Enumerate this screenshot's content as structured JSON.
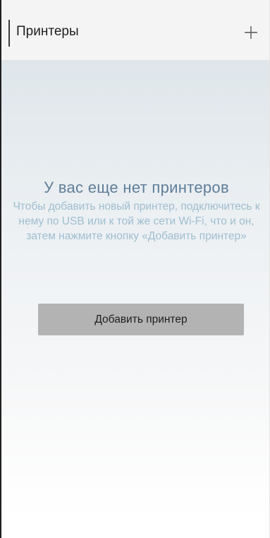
{
  "header": {
    "title": "Принтеры",
    "add_icon": "plus-icon"
  },
  "empty_state": {
    "title": "У вас еще нет принтеров",
    "description": "Чтобы добавить новый принтер, подключитесь к нему по USB или к той же сети Wi-Fi, что и он, затем нажмите кнопку «Добавить принтер»",
    "button_label": "Добавить принтер"
  },
  "colors": {
    "title_text": "#1f1f1f",
    "empty_title": "#5f7e99",
    "empty_text": "#9fbdce",
    "button_bg": "#b3b3b3",
    "header_bg": "#f4f4f5"
  }
}
